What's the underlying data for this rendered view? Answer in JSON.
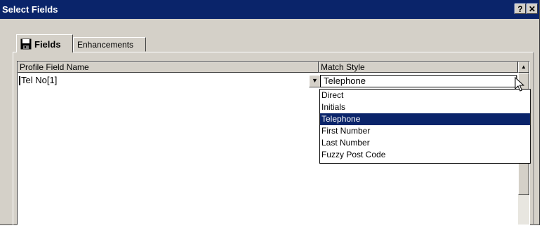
{
  "window": {
    "title": "Select Fields",
    "help_label": "?",
    "close_label": "✕"
  },
  "tabs": [
    {
      "label": "Fields",
      "icon": "floppy-disk-icon",
      "active": true
    },
    {
      "label": "Enhancements",
      "active": false
    }
  ],
  "grid": {
    "columns": [
      "Profile Field Name",
      "Match Style"
    ],
    "row": {
      "field_name": "Tel No[1]",
      "match_style": "Telephone"
    }
  },
  "dropdown": {
    "options": [
      "Direct",
      "Initials",
      "Telephone",
      "First Number",
      "Last Number",
      "Fuzzy Post Code"
    ],
    "selected": "Telephone"
  },
  "colors": {
    "titlebar": "#0a246a",
    "selection": "#0a246a",
    "face": "#d4d0c8"
  }
}
